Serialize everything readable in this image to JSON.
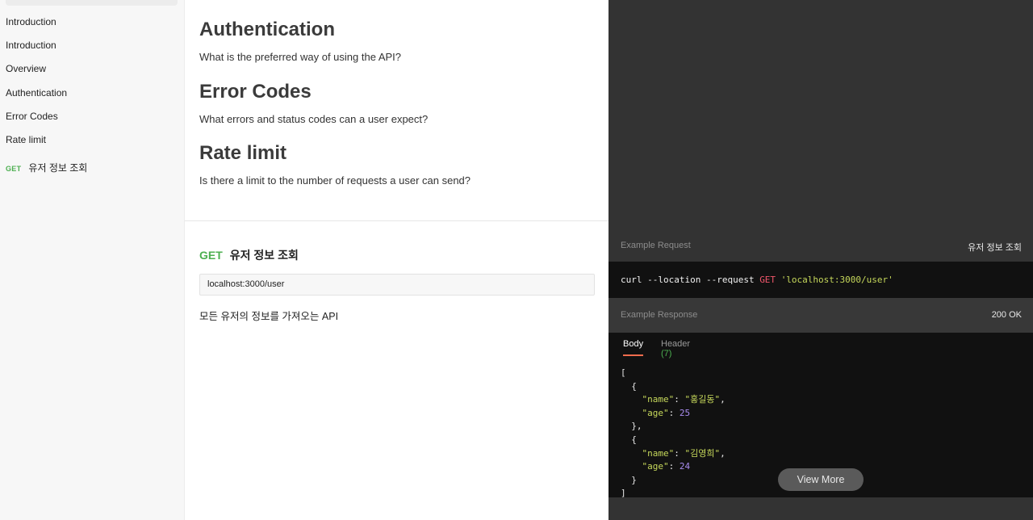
{
  "sidebar": {
    "items": [
      {
        "label": "Introduction"
      },
      {
        "label": "Introduction"
      },
      {
        "label": "Overview"
      },
      {
        "label": "Authentication"
      },
      {
        "label": "Error Codes"
      },
      {
        "label": "Rate limit"
      }
    ],
    "endpoint": {
      "method": "GET",
      "label": "유저 정보 조회"
    }
  },
  "main": {
    "sections": [
      {
        "title": "Authentication",
        "desc": "What is the preferred way of using the API?"
      },
      {
        "title": "Error Codes",
        "desc": "What errors and status codes can a user expect?"
      },
      {
        "title": "Rate limit",
        "desc": "Is there a limit to the number of requests a user can send?"
      }
    ],
    "endpoint": {
      "method": "GET",
      "title": "유저 정보 조회",
      "url": "localhost:3000/user",
      "description": "모든 유저의 정보를 가져오는 API"
    }
  },
  "right": {
    "example_request": {
      "label": "Example Request",
      "name": "유저 정보 조회",
      "curl_prefix": "curl --location --request ",
      "curl_method": "GET",
      "curl_url": "'localhost:3000/user'"
    },
    "example_response": {
      "label": "Example Response",
      "status": "200 OK",
      "tabs": {
        "body": "Body",
        "header": "Header",
        "header_count": "(7)"
      },
      "users": [
        {
          "name": "\"홍길동\"",
          "age": "25"
        },
        {
          "name": "\"김영희\"",
          "age": "24"
        }
      ],
      "view_more": "View More"
    }
  },
  "colors": {
    "get_method": "#4caf50",
    "panel_bg": "#333333",
    "code_bg": "#111111",
    "tab_underline": "#ef6c4d"
  }
}
